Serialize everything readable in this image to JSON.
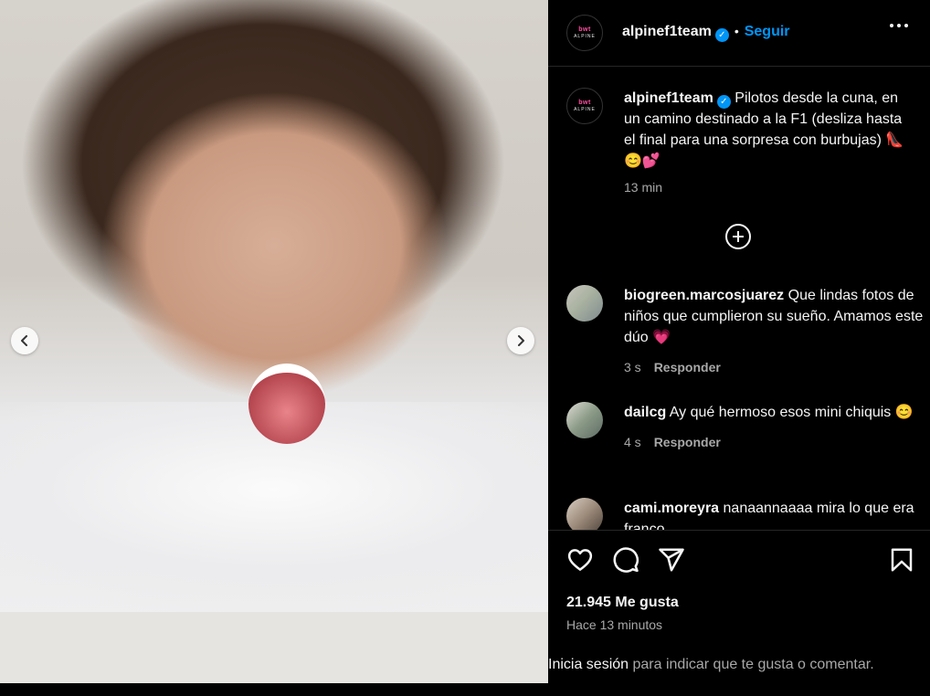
{
  "post": {
    "username": "alpinef1team",
    "verified_mark": "✓",
    "follow_label": "Seguir",
    "separator": "•",
    "avatar_logo_top": "bwt",
    "avatar_logo_bottom": "ALPINE",
    "more_icon": "more-horizontal-icon",
    "media_icons": {
      "prev": "chevron-left-icon",
      "next": "chevron-right-icon"
    }
  },
  "caption": {
    "username": "alpinef1team",
    "text": "Pilotos desde la cuna, en un camino destinado a la F1 (desliza hasta el final para una sorpresa con burbujas) 👠😊💕",
    "time": "13 min"
  },
  "comments": [
    {
      "username": "biogreen.marcosjuarez",
      "text": "Que lindas fotos de niños que cumplieron su sueño. Amamos este dúo 💗",
      "time": "3 s",
      "reply_label": "Responder"
    },
    {
      "username": "dailcg",
      "text": "Ay qué hermoso esos mini chiquis 😊",
      "time": "4 s",
      "reply_label": "Responder"
    },
    {
      "username": "cami.moreyra",
      "text": "nanaannaaaa mira lo que era franco",
      "time": "",
      "reply_label": ""
    }
  ],
  "actions": {
    "icons": [
      "heart-icon",
      "comment-icon",
      "share-icon",
      "bookmark-icon"
    ],
    "likes": "21.945 Me gusta",
    "posted": "Hace 13 minutos"
  },
  "login_bar": {
    "link": "Inicia sesión",
    "text": " para indicar que te gusta o comentar."
  },
  "colors": {
    "background": "#000000",
    "accent": "#0095f6",
    "text_primary": "#f5f5f5",
    "text_secondary": "#a8a8a8",
    "divider": "#262626"
  }
}
